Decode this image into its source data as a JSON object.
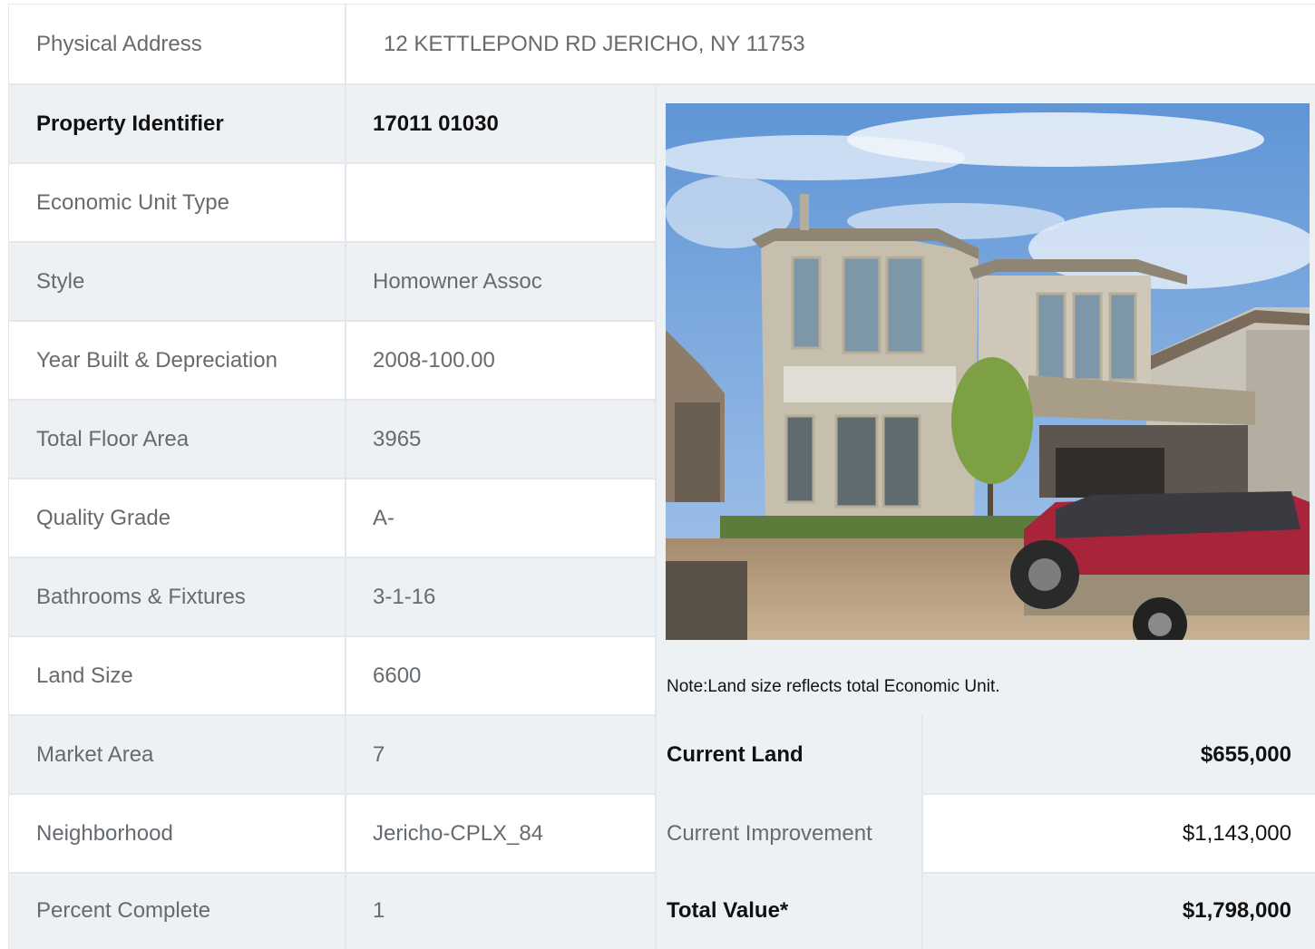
{
  "address": {
    "label": "Physical Address",
    "value": "12  KETTLEPOND RD  JERICHO, NY  11753"
  },
  "rows": [
    {
      "label": "Property Identifier",
      "value": "17011  01030"
    },
    {
      "label": "Economic Unit Type",
      "value": ""
    },
    {
      "label": "Style",
      "value": "Homowner Assoc"
    },
    {
      "label": "Year Built & Depreciation",
      "value": "2008-100.00"
    },
    {
      "label": "Total Floor Area",
      "value": "3965"
    },
    {
      "label": "Quality Grade",
      "value": "A-"
    },
    {
      "label": "Bathrooms & Fixtures",
      "value": "3-1-16"
    },
    {
      "label": "Land Size",
      "value": "6600"
    },
    {
      "label": "Market Area",
      "value": "7"
    },
    {
      "label": "Neighborhood",
      "value": "Jericho-CPLX_84"
    },
    {
      "label": "Percent Complete",
      "value": "1"
    }
  ],
  "note": "Note:Land size reflects total Economic Unit.",
  "values": [
    {
      "label": "Current Land",
      "value": "$655,000"
    },
    {
      "label": "Current Improvement",
      "value": "$1,143,000"
    },
    {
      "label": "Total Value*",
      "value": "$1,798,000"
    }
  ]
}
